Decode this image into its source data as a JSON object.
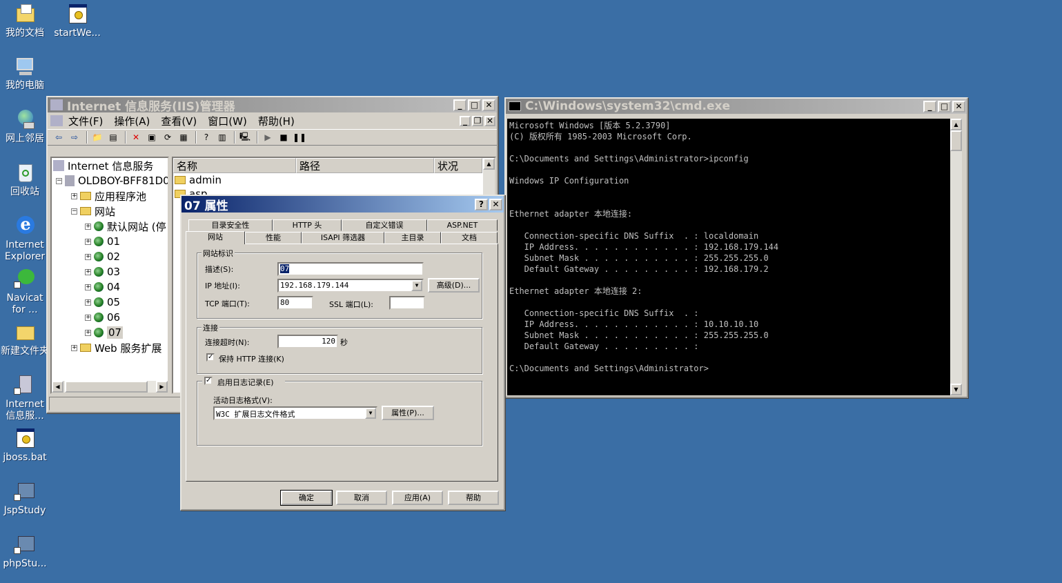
{
  "desktop": {
    "icons": [
      {
        "label": "我的文档"
      },
      {
        "label": "startWe..."
      },
      {
        "label": "我的电脑"
      },
      {
        "label": "网上邻居"
      },
      {
        "label": "回收站"
      },
      {
        "label": "Internet Explorer"
      },
      {
        "label": "Navicat for ..."
      },
      {
        "label": "新建文件夹"
      },
      {
        "label": "Internet 信息服..."
      },
      {
        "label": "jboss.bat"
      },
      {
        "label": "JspStudy"
      },
      {
        "label": "phpStu..."
      }
    ]
  },
  "iis": {
    "title": "Internet 信息服务(IIS)管理器",
    "menu": [
      "文件(F)",
      "操作(A)",
      "查看(V)",
      "窗口(W)",
      "帮助(H)"
    ],
    "tree": {
      "root": "Internet 信息服务",
      "server": "OLDBOY-BFF81D0",
      "app_pools": "应用程序池",
      "websites": "网站",
      "default_site": "默认网站 (停",
      "sites": [
        "01",
        "02",
        "03",
        "04",
        "05",
        "06",
        "07"
      ],
      "web_ext": "Web 服务扩展"
    },
    "list": {
      "columns": [
        "名称",
        "路径",
        "状况"
      ],
      "rows": [
        "admin",
        "asp"
      ]
    }
  },
  "dialog": {
    "title": "07 属性",
    "tabs_row1": [
      "目录安全性",
      "HTTP 头",
      "自定义错误",
      "ASP.NET"
    ],
    "tabs_row2": [
      "网站",
      "性能",
      "ISAPI 筛选器",
      "主目录",
      "文档"
    ],
    "site_id_group": "网站标识",
    "desc_label": "描述(S):",
    "desc_value": "07",
    "ip_label": "IP 地址(I):",
    "ip_value": "192.168.179.144",
    "advanced_btn": "高级(D)...",
    "tcp_label": "TCP 端口(T):",
    "tcp_value": "80",
    "ssl_label": "SSL 端口(L):",
    "ssl_value": "",
    "conn_group": "连接",
    "timeout_label": "连接超时(N):",
    "timeout_value": "120",
    "timeout_unit": "秒",
    "keepalive_label": "保持 HTTP 连接(K)",
    "keepalive_checked": true,
    "logging_label": "启用日志记录(E)",
    "logging_checked": true,
    "log_format_label": "活动日志格式(V):",
    "log_format_value": "W3C 扩展日志文件格式",
    "props_btn": "属性(P)...",
    "ok": "确定",
    "cancel": "取消",
    "apply": "应用(A)",
    "help": "帮助"
  },
  "cmd": {
    "title": "C:\\Windows\\system32\\cmd.exe",
    "lines": [
      "Microsoft Windows [版本 5.2.3790]",
      "(C) 版权所有 1985-2003 Microsoft Corp.",
      "",
      "C:\\Documents and Settings\\Administrator>ipconfig",
      "",
      "Windows IP Configuration",
      "",
      "",
      "Ethernet adapter 本地连接:",
      "",
      "   Connection-specific DNS Suffix  . : localdomain",
      "   IP Address. . . . . . . . . . . . : 192.168.179.144",
      "   Subnet Mask . . . . . . . . . . . : 255.255.255.0",
      "   Default Gateway . . . . . . . . . : 192.168.179.2",
      "",
      "Ethernet adapter 本地连接 2:",
      "",
      "   Connection-specific DNS Suffix  . :",
      "   IP Address. . . . . . . . . . . . : 10.10.10.10",
      "   Subnet Mask . . . . . . . . . . . : 255.255.255.0",
      "   Default Gateway . . . . . . . . . :",
      "",
      "C:\\Documents and Settings\\Administrator>"
    ]
  }
}
